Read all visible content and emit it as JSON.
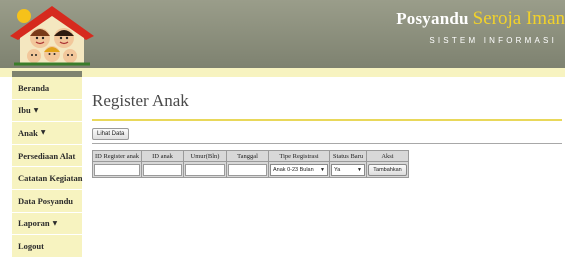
{
  "header": {
    "brand_main": "Posyandu",
    "brand_accent": "Seroja Iman",
    "brand_subtitle": "SISTEM INFORMASI",
    "logo": "family-house-logo"
  },
  "sidebar": {
    "items": [
      {
        "label": "Beranda",
        "caret": ""
      },
      {
        "label": "Ibu",
        "caret": "▼"
      },
      {
        "label": "Anak",
        "caret": "▼"
      },
      {
        "label": "Persediaan Alat",
        "caret": ""
      },
      {
        "label": "Catatan Kegiatan",
        "caret": ""
      },
      {
        "label": "Data Posyandu",
        "caret": ""
      },
      {
        "label": "Laporan",
        "caret": "▼"
      },
      {
        "label": "Logout",
        "caret": ""
      }
    ]
  },
  "main": {
    "title": "Register Anak",
    "view_button": "Lihat Data",
    "table": {
      "columns": [
        "ID Register anak",
        "ID anak",
        "Umur(Bln)",
        "Tanggal",
        "Tipe Registrasi",
        "Status Baru",
        "Aksi"
      ],
      "row": {
        "tipe_registrasi": "Anak 0-23 Bulan",
        "status_baru": "Ya",
        "action_label": "Tambahkan"
      }
    }
  },
  "colors": {
    "header_bg": "#8a8e7a",
    "accent_yellow": "#f2d22a",
    "sidebar_bg": "#f7f3c0",
    "title_rule": "#e9d85a"
  }
}
